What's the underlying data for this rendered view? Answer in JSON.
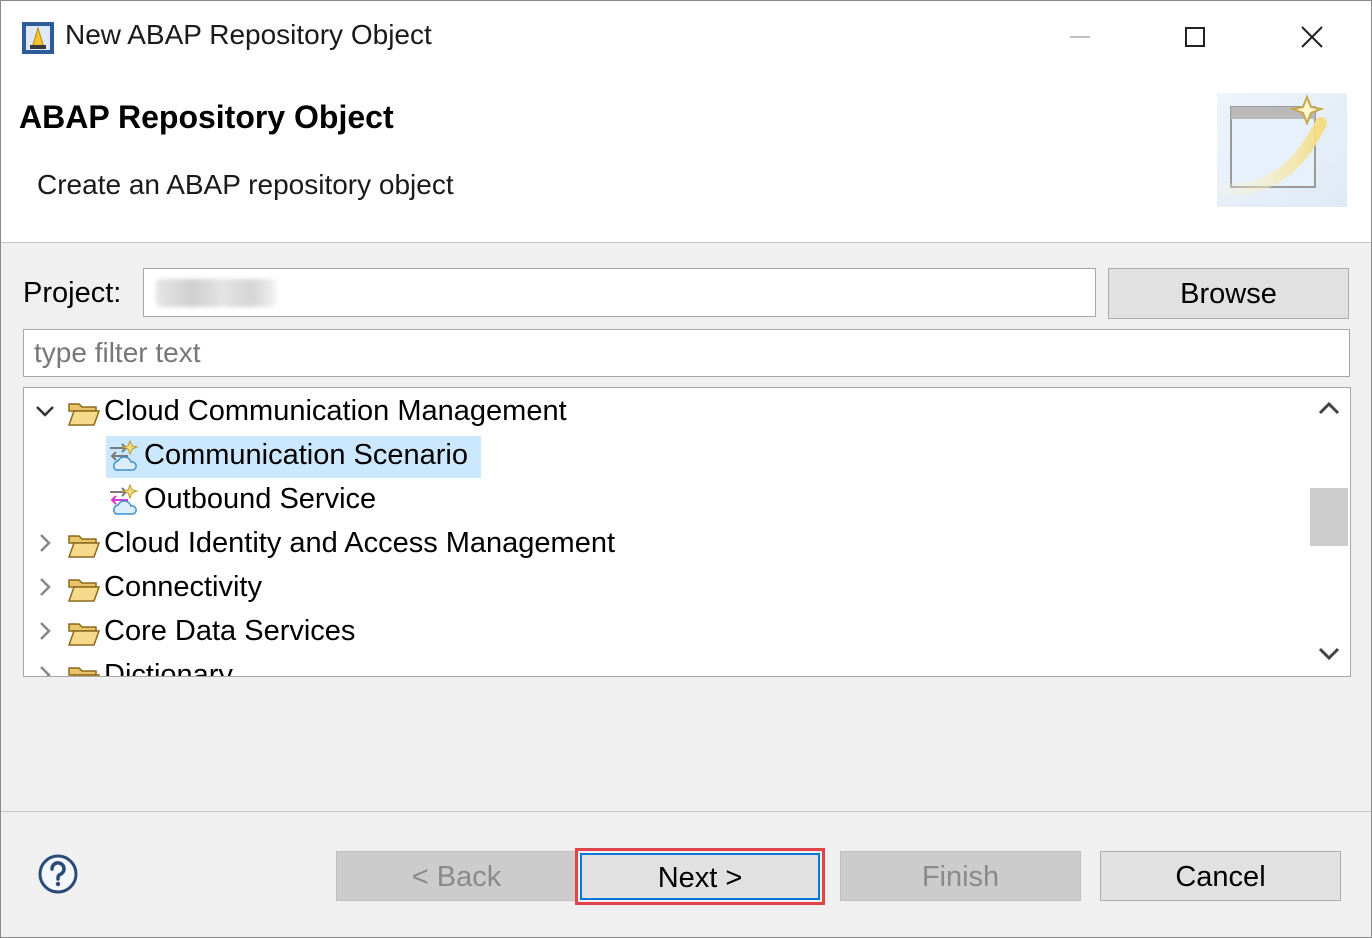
{
  "window": {
    "title": "New ABAP Repository Object",
    "controls": [
      "minimize",
      "maximize",
      "close"
    ]
  },
  "banner": {
    "title": "ABAP Repository Object",
    "description": "Create an ABAP repository object"
  },
  "project": {
    "label": "Project:",
    "value": "",
    "browse_label": "Browse"
  },
  "filter": {
    "placeholder": "type filter text",
    "value": ""
  },
  "tree": {
    "items": [
      {
        "label": "Cloud Communication Management",
        "type": "folder",
        "expanded": true
      },
      {
        "label": "Communication Scenario",
        "type": "item",
        "selected": true
      },
      {
        "label": "Outbound Service",
        "type": "item"
      },
      {
        "label": "Cloud Identity and Access Management",
        "type": "folder",
        "expanded": false
      },
      {
        "label": "Connectivity",
        "type": "folder",
        "expanded": false
      },
      {
        "label": "Core Data Services",
        "type": "folder",
        "expanded": false
      },
      {
        "label": "Dictionary",
        "type": "folder",
        "expanded": false
      }
    ]
  },
  "buttons": {
    "back": "< Back",
    "next": "Next >",
    "finish": "Finish",
    "cancel": "Cancel"
  },
  "icons": {
    "app": "abap-app-icon",
    "help": "help-icon",
    "wizard": "new-wizard-graphic"
  },
  "colors": {
    "selection": "#cce8ff",
    "highlight_outline": "#e0434a",
    "default_button_border": "#0078d7"
  }
}
